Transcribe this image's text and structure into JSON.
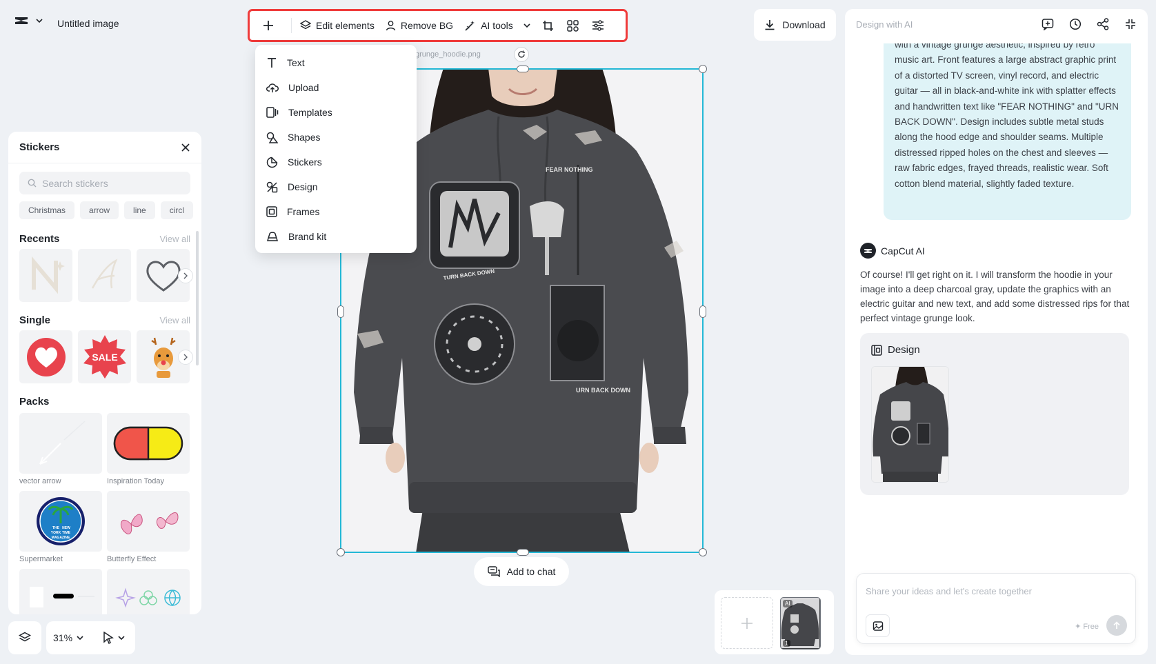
{
  "header": {
    "doc_title": "Untitled image",
    "download_label": "Download"
  },
  "toolbar": {
    "edit_elements": "Edit elements",
    "remove_bg": "Remove BG",
    "ai_tools": "AI tools"
  },
  "add_menu": {
    "items": [
      {
        "label": "Text",
        "icon": "text-icon"
      },
      {
        "label": "Upload",
        "icon": "upload-icon"
      },
      {
        "label": "Templates",
        "icon": "templates-icon"
      },
      {
        "label": "Shapes",
        "icon": "shapes-icon"
      },
      {
        "label": "Stickers",
        "icon": "stickers-icon"
      },
      {
        "label": "Design",
        "icon": "design-icon"
      },
      {
        "label": "Frames",
        "icon": "frames-icon"
      },
      {
        "label": "Brand kit",
        "icon": "brand-kit-icon"
      }
    ]
  },
  "stickers": {
    "title": "Stickers",
    "search_placeholder": "Search stickers",
    "chips": [
      "Christmas",
      "arrow",
      "line",
      "circl"
    ],
    "recents_title": "Recents",
    "single_title": "Single",
    "view_all": "View all",
    "packs_title": "Packs",
    "packs": [
      "vector arrow",
      "Inspiration Today",
      "Supermarket",
      "Butterfly Effect"
    ],
    "sale_text": "SALE",
    "badge_text": [
      "THE",
      "NEW",
      "YORK",
      "TIME",
      "MAGAZINE"
    ]
  },
  "bottom": {
    "zoom": "31%"
  },
  "canvas": {
    "file_label": "grunge_hoodie.png",
    "add_to_chat": "Add to chat",
    "print_text_1": "FEAR NOTHING",
    "print_text_2": "URN BACK DOWN",
    "print_text_3": "TURN BACK DOWN"
  },
  "pages": {
    "ai_badge": "AI",
    "page_number": "1"
  },
  "ai_panel": {
    "title": "Design with AI",
    "user_message": "with a vintage grunge aesthetic, inspired by retro music art. Front features a large abstract graphic print of a distorted TV screen, vinyl record, and electric guitar — all in black-and-white ink with splatter effects and handwritten text like \"FEAR NOTHING\" and \"URN BACK DOWN\". Design includes subtle metal studs along the hood edge and shoulder seams. Multiple distressed ripped holes on the chest and sleeves — raw fabric edges, frayed threads, realistic wear. Soft cotton blend material, slightly faded texture.",
    "assistant_name": "CapCut AI",
    "assistant_reply": "Of course! I'll get right on it. I will transform the hoodie in your image into a deep charcoal gray, update the graphics with an electric guitar and new text, and add some distressed rips for that perfect vintage grunge look.",
    "design_card_title": "Design",
    "prompt_placeholder": "Share your ideas and let's create together",
    "free_label": "✦ Free"
  },
  "colors": {
    "selection": "#22b8d6",
    "toolbar_highlight": "#ef3b3b",
    "user_bubble": "#dff3f7"
  }
}
